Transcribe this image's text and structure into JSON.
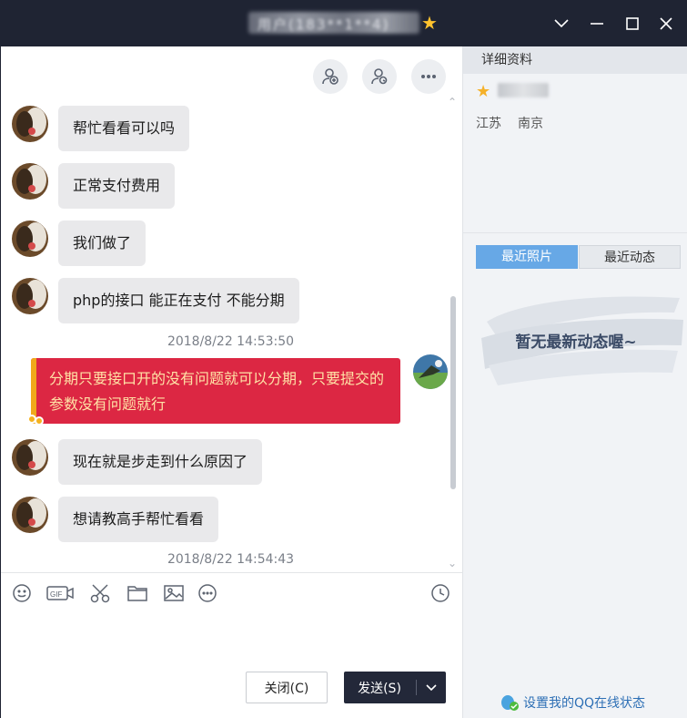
{
  "titlebar": {
    "contact_name": "用户(183**1**4)",
    "minimize_label": "minimize",
    "maximize_label": "maximize",
    "close_label": "close"
  },
  "chat": {
    "top_actions": [
      {
        "icon": "add-contact-icon"
      },
      {
        "icon": "contact-settings-icon"
      },
      {
        "icon": "more-icon"
      }
    ],
    "messages": [
      {
        "sender": "other",
        "text": "帮忙看看可以吗"
      },
      {
        "sender": "other",
        "text": "正常支付费用"
      },
      {
        "sender": "other",
        "text": "我们做了"
      },
      {
        "sender": "other",
        "text": "php的接口  能正在支付 不能分期"
      },
      {
        "timestamp": "2018/8/22 14:53:50"
      },
      {
        "sender": "me",
        "text": "分期只要接口开的没有问题就可以分期，只要提交的参数没有问题就行"
      },
      {
        "sender": "other",
        "text": "现在就是步走到什么原因了"
      },
      {
        "sender": "other",
        "text": "想请教高手帮忙看看"
      },
      {
        "timestamp": "2018/8/22 14:54:43"
      }
    ]
  },
  "input_toolbar": {
    "icons": [
      "emoji-icon",
      "gif-icon",
      "scissors-icon",
      "folder-icon",
      "image-icon",
      "more-icon",
      "history-icon"
    ],
    "gif_text": "GIF"
  },
  "buttons": {
    "close_label": "关闭(C)",
    "send_label": "发送(S)"
  },
  "side_panel": {
    "header": "详细资料",
    "province": "江苏",
    "city": "南京",
    "tabs": [
      "最近照片",
      "最近动态"
    ],
    "active_tab": "最近照片",
    "empty_text": "暂无最新动态喔~",
    "status_link": "设置我的QQ在线状态"
  },
  "colors": {
    "titlebar_bg": "#1f2433",
    "bubble_bg": "#e9e9eb",
    "my_bubble_bg": "#dc2743",
    "my_bubble_text": "#ffe2a6",
    "tab_active": "#67a8e6",
    "link": "#2d6fb5"
  }
}
